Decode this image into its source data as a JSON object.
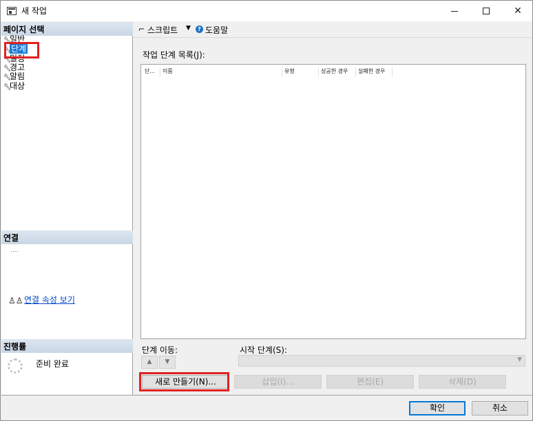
{
  "window": {
    "title": "새 작업",
    "controls": {
      "minimize": "",
      "maximize": "",
      "close": "✕"
    }
  },
  "left": {
    "pages_header": "페이지 선택",
    "pages": [
      {
        "label": "일반"
      },
      {
        "label": "단계",
        "selected": true
      },
      {
        "label": "일정"
      },
      {
        "label": "경고"
      },
      {
        "label": "알림"
      },
      {
        "label": "대상"
      }
    ],
    "connection_header": "연결",
    "connection_value": "....",
    "connection_link": "연결 속성 보기",
    "progress_header": "진행률",
    "progress_status": "준비 완료"
  },
  "toolbar": {
    "script_label": "스크립트",
    "help_label": "도움말"
  },
  "main": {
    "list_label": "작업 단계 목록(J):",
    "columns": [
      "단...",
      "이름",
      "유형",
      "성공한 경우",
      "실패한 경우"
    ],
    "move_label": "단계 이동:",
    "start_label": "시작 단계(S):",
    "start_value": ""
  },
  "buttons": {
    "new": "새로 만들기(N)...",
    "insert": "삽입(I)...",
    "edit": "편집(E)",
    "delete": "삭제(D)"
  },
  "footer": {
    "ok": "확인",
    "cancel": "취소"
  },
  "colors": {
    "selection": "#1e7bd6",
    "highlight_box": "#e02020",
    "link": "#0047c8",
    "ok_border": "#0078d7"
  }
}
